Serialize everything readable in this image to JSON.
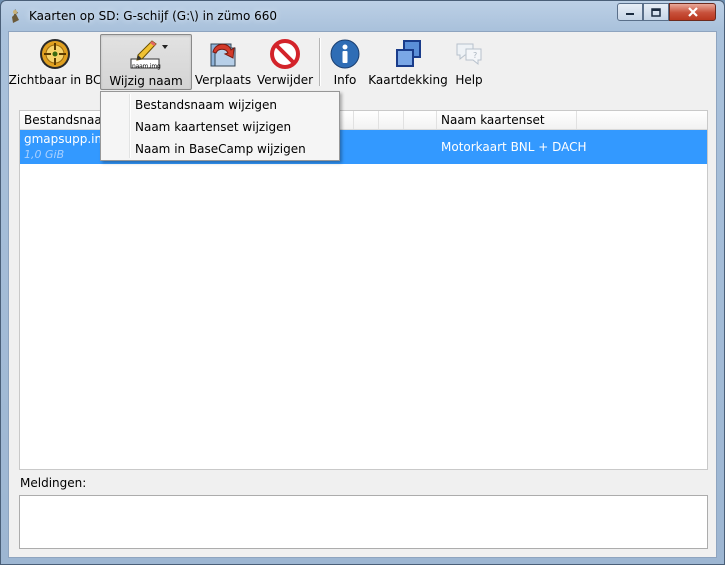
{
  "window": {
    "title": "Kaarten op SD: G-schijf (G:\\) in zümo 660"
  },
  "toolbar": {
    "buttons": [
      {
        "label": "Zichtbaar in BC",
        "icon": "crosshair-target-icon"
      },
      {
        "label": "Wijzig naam",
        "icon": "pencil-rename-icon",
        "icon_text": "naam.img"
      },
      {
        "label": "Verplaats",
        "icon": "move-arrow-icon"
      },
      {
        "label": "Verwijder",
        "icon": "no-entry-icon"
      },
      {
        "label": "Info",
        "icon": "info-icon"
      },
      {
        "label": "Kaartdekking",
        "icon": "map-coverage-icon"
      },
      {
        "label": "Help",
        "icon": "help-icon"
      }
    ]
  },
  "menu": {
    "items": [
      "Bestandsnaam wijzigen",
      "Naam kaartenset wijzigen",
      "Naam in BaseCamp wijzigen"
    ]
  },
  "list": {
    "columns": [
      "Bestandsnaam",
      "Naam kaartenset"
    ],
    "rows": [
      {
        "file": "gmapsupp.img",
        "size": "1,0 GiB",
        "name": "Motorkaart BNL + DACH"
      }
    ]
  },
  "messages": {
    "label": "Meldingen:",
    "content": ""
  },
  "colors": {
    "selection": "#3399ff",
    "info_blue": "#2f6db5",
    "stop_red": "#d3232a"
  }
}
